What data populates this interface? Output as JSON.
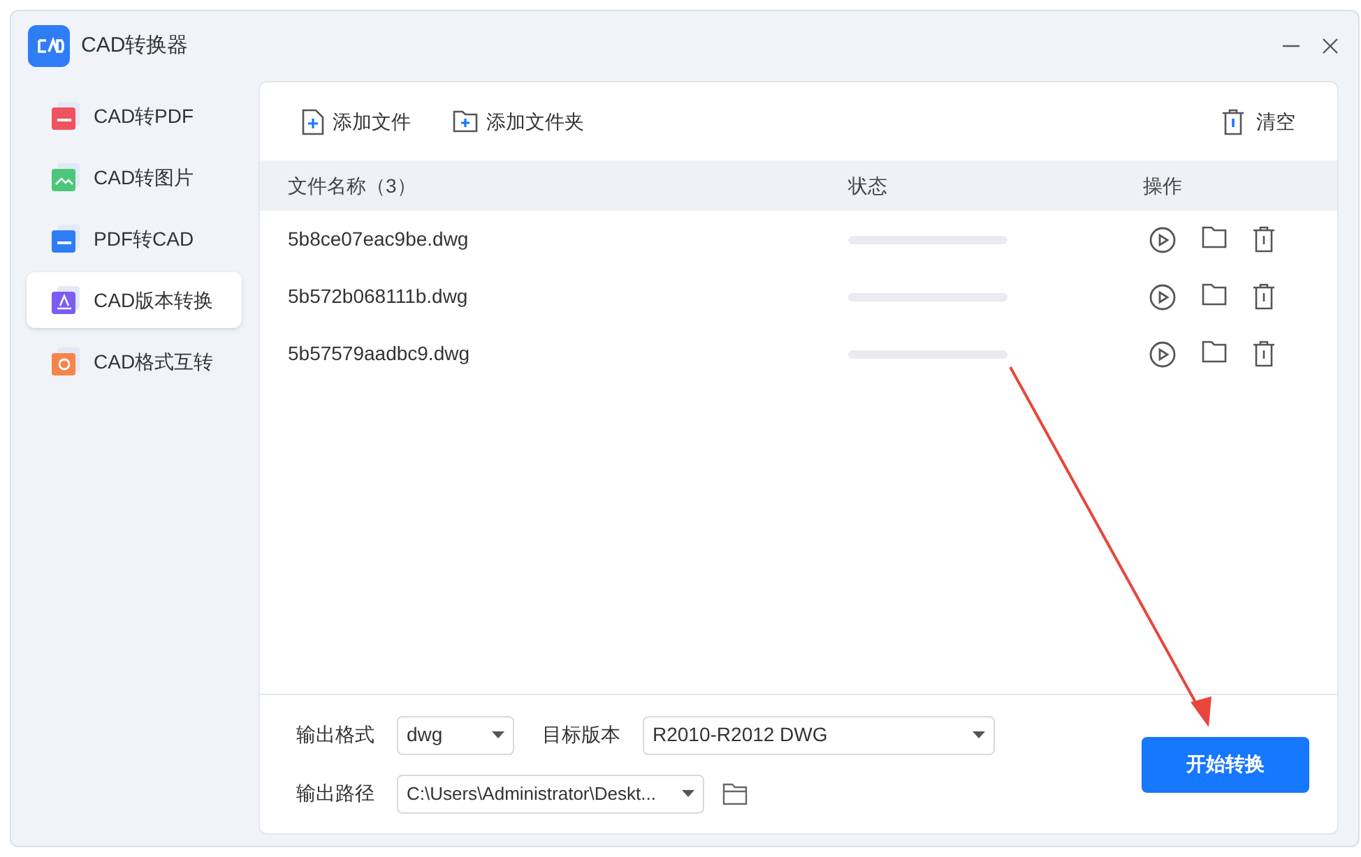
{
  "window": {
    "title": "CAD转换器"
  },
  "sidebar": {
    "items": [
      {
        "label": "CAD转PDF",
        "kind": "pdf",
        "selected": false
      },
      {
        "label": "CAD转图片",
        "kind": "image",
        "selected": false
      },
      {
        "label": "PDF转CAD",
        "kind": "cad",
        "selected": false
      },
      {
        "label": "CAD版本转换",
        "kind": "version",
        "selected": true
      },
      {
        "label": "CAD格式互转",
        "kind": "format",
        "selected": false
      }
    ]
  },
  "toolbar": {
    "add_file": "添加文件",
    "add_folder": "添加文件夹",
    "clear": "清空"
  },
  "table": {
    "columns": [
      "文件名称（3）",
      "状态",
      "操作"
    ],
    "rows": [
      {
        "name": "5b8ce07eac9be.dwg",
        "level": 0
      },
      {
        "name": "5b572b068111b.dwg",
        "level": 0
      },
      {
        "name": "5b57579aadbc9.dwg",
        "level": 0
      }
    ]
  },
  "options": {
    "format_label": "输出格式",
    "format": "dwg",
    "version_label": "目标版本",
    "version": "R2010-R2012 DWG",
    "path_label": "输出路径",
    "path": "C:\\Users\\Administrator\\Deskt..."
  },
  "start_button": "开始转换"
}
